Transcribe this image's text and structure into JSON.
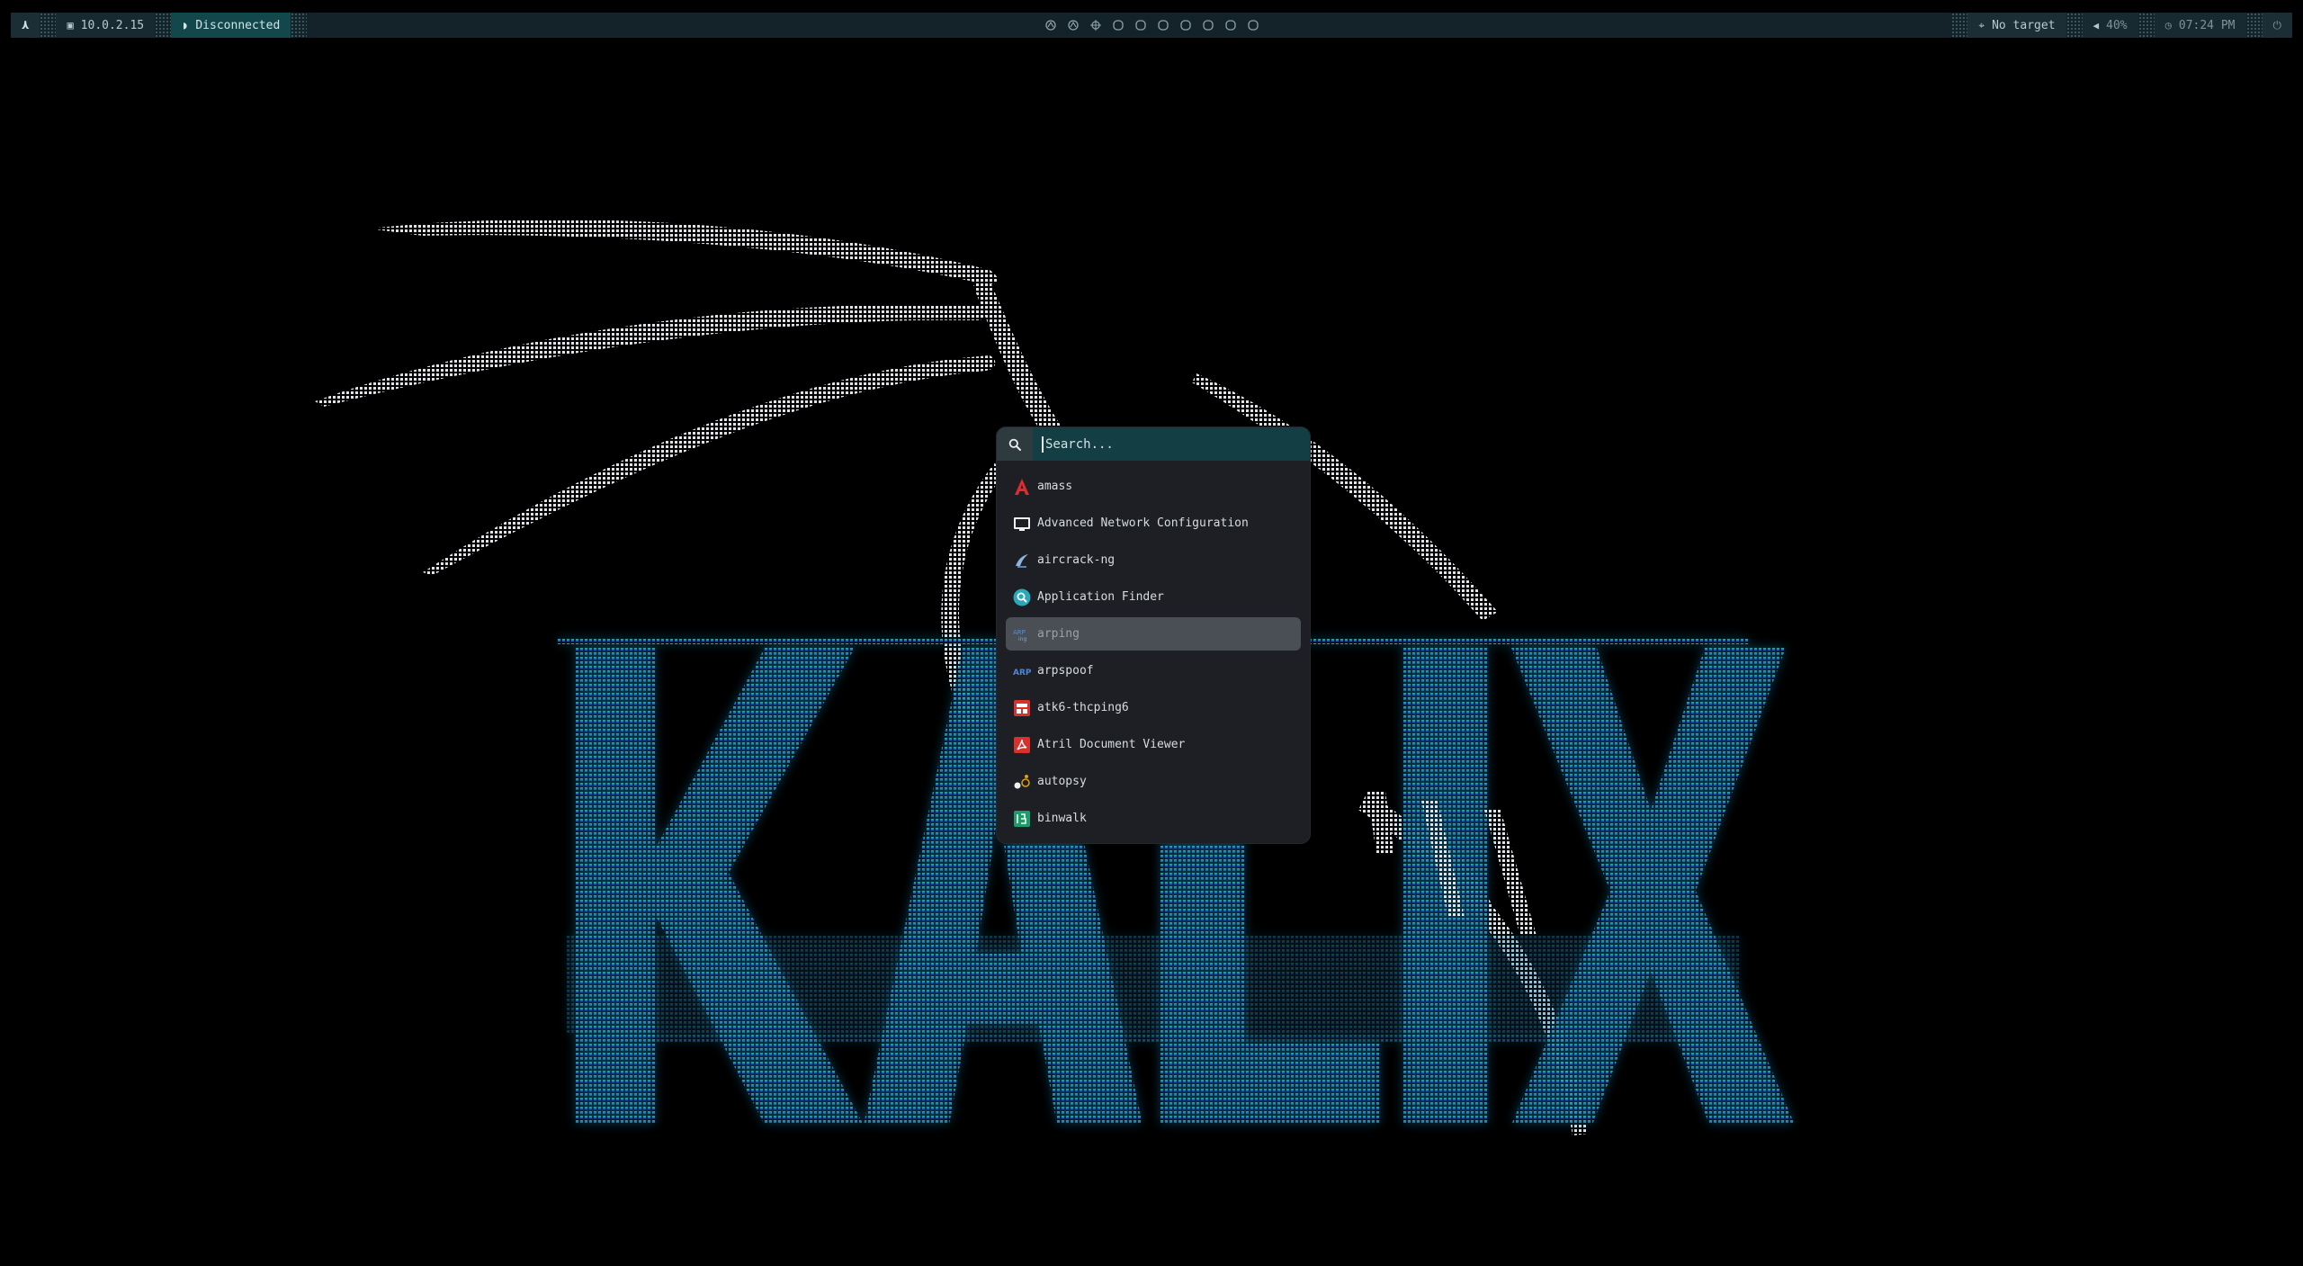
{
  "topbar": {
    "logo_icon": "kali-dragon-icon",
    "ip_address": "10.0.2.15",
    "vpn_status": "Disconnected",
    "target": "No target",
    "volume": "40%",
    "clock": "07:24 PM",
    "workspaces": [
      {
        "icon": "kali-icon"
      },
      {
        "icon": "kali-icon"
      },
      {
        "icon": "crosshair-icon"
      },
      {
        "icon": "circle-icon"
      },
      {
        "icon": "circle-icon"
      },
      {
        "icon": "circle-icon"
      },
      {
        "icon": "circle-icon"
      },
      {
        "icon": "circle-icon"
      },
      {
        "icon": "circle-icon"
      },
      {
        "icon": "circle-icon"
      }
    ]
  },
  "launcher": {
    "search_placeholder": "Search...",
    "items": [
      {
        "label": "amass",
        "icon": "amass-icon"
      },
      {
        "label": "Advanced Network Configuration",
        "icon": "monitor-icon"
      },
      {
        "label": "aircrack-ng",
        "icon": "aircrack-icon"
      },
      {
        "label": "Application Finder",
        "icon": "app-finder-icon"
      },
      {
        "label": "arping",
        "icon": "arping-icon",
        "selected": true
      },
      {
        "label": "arpspoof",
        "icon": "arpspoof-icon"
      },
      {
        "label": "atk6-thcping6",
        "icon": "atk6-icon"
      },
      {
        "label": "Atril Document Viewer",
        "icon": "pdf-viewer-icon"
      },
      {
        "label": "autopsy",
        "icon": "autopsy-icon"
      },
      {
        "label": "binwalk",
        "icon": "binwalk-icon"
      }
    ]
  },
  "colors": {
    "bar_bg": "#14232a",
    "bar_teal": "#12474b",
    "launcher_bg": "#1d1f25",
    "selected_bg": "#4a4e55",
    "wallpaper_teal": "#1fb5b5",
    "wallpaper_blue": "#2a5ee8"
  }
}
